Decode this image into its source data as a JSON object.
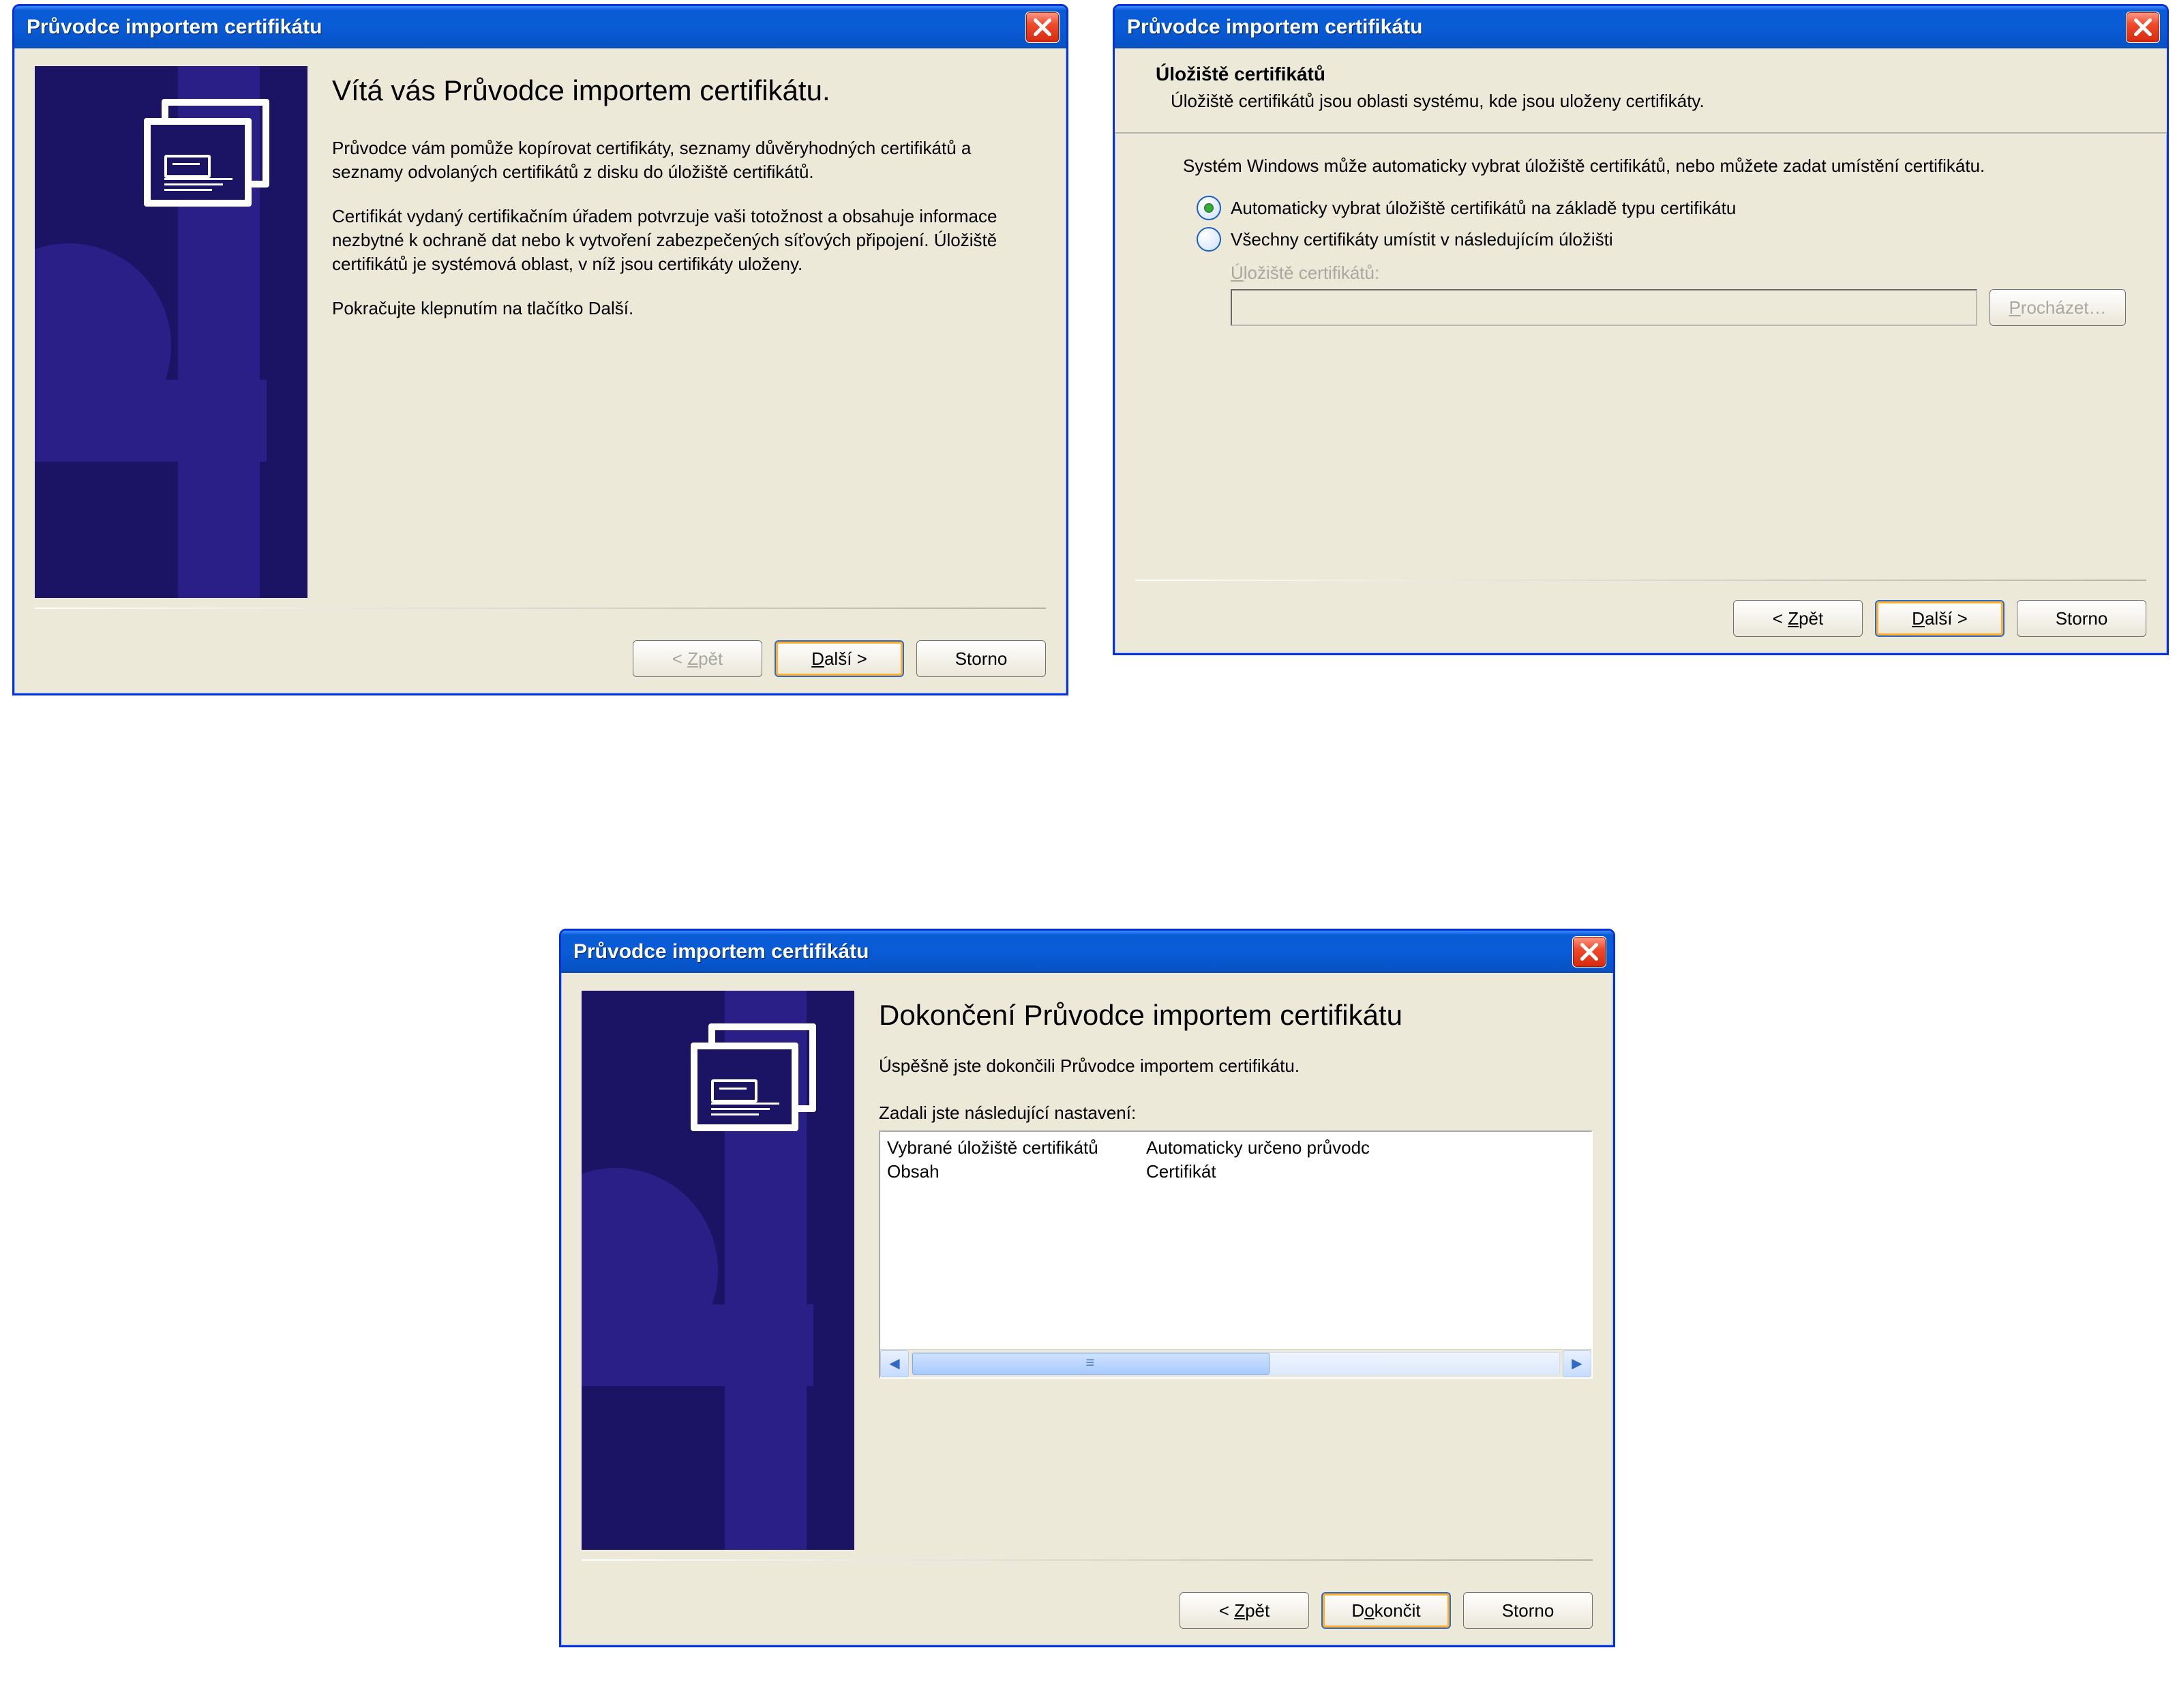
{
  "window_title": "Průvodce importem certifikátu",
  "buttons": {
    "back": "< Zpět",
    "next": "Další >",
    "cancel": "Storno",
    "finish": "Dokončit",
    "browse": "Procházet…"
  },
  "w1": {
    "heading": "Vítá vás Průvodce importem certifikátu.",
    "p1": "Průvodce vám pomůže kopírovat certifikáty, seznamy důvěryhodných certifikátů a seznamy odvolaných certifikátů z disku do úložiště certifikátů.",
    "p2": "Certifikát vydaný certifikačním úřadem potvrzuje vaši totožnost a obsahuje informace nezbytné k ochraně dat nebo k vytvoření zabezpečených síťových připojení. Úložiště certifikátů je systémová oblast, v níž jsou certifikáty uloženy.",
    "p3": "Pokračujte klepnutím na tlačítko Další."
  },
  "w2": {
    "header": "Úložiště certifikátů",
    "sub": "Úložiště certifikátů jsou oblasti systému, kde jsou uloženy certifikáty.",
    "inst": "Systém Windows může automaticky vybrat úložiště certifikátů, nebo můžete zadat umístění certifikátu.",
    "opt_auto": "Automaticky vybrat úložiště certifikátů na základě typu certifikátu",
    "opt_manual": "Všechny certifikáty umístit v následujícím úložišti",
    "store_label": "Úložiště certifikátů:"
  },
  "w3": {
    "heading": "Dokončení Průvodce importem certifikátu",
    "success": "Úspěšně jste dokončili Průvodce importem certifikátu.",
    "settings_label": "Zadali jste následující nastavení:",
    "rows": [
      {
        "k": "Vybrané úložiště certifikátů",
        "v": "Automaticky určeno průvodc"
      },
      {
        "k": "Obsah",
        "v": "Certifikát"
      }
    ]
  }
}
